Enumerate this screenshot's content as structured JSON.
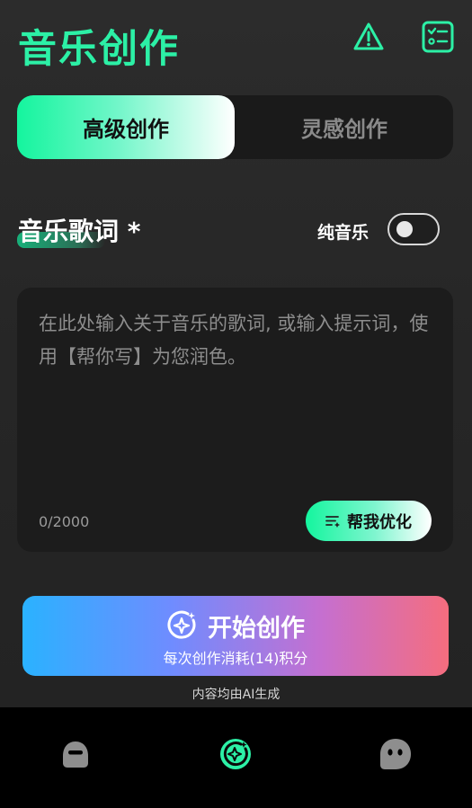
{
  "header": {
    "title": "音乐创作",
    "icons": [
      "warning-icon",
      "checklist-icon"
    ]
  },
  "tabs": [
    {
      "label": "高级创作",
      "active": true
    },
    {
      "label": "灵感创作",
      "active": false
    }
  ],
  "lyrics": {
    "title": "音乐歌词 *",
    "pure_music_label": "纯音乐",
    "pure_music_on": false,
    "placeholder": "在此处输入关于音乐的歌词, 或输入提示词，使用【帮你写】为您润色。",
    "value": "",
    "counter": "0/2000",
    "help_button_label": "帮我优化"
  },
  "start": {
    "label": "开始创作",
    "sub": "每次创作消耗(14)积分"
  },
  "ai_note": "内容均由AI生成",
  "bottom_nav": [
    {
      "icon": "chat-bubble-icon",
      "active": false
    },
    {
      "icon": "create-icon",
      "active": true
    },
    {
      "icon": "face-icon",
      "active": false
    }
  ],
  "colors": {
    "accent": "#2cf0a6",
    "background": "#262626",
    "nav_background": "#000000"
  }
}
